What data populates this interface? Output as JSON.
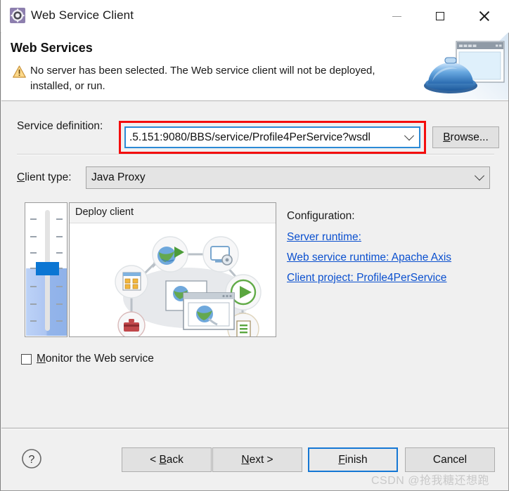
{
  "window": {
    "title": "Web Service Client",
    "icon": "gear-icon",
    "controls": {
      "minimize": "minimize-icon",
      "maximize": "maximize-icon",
      "close": "close-icon"
    }
  },
  "header": {
    "title": "Web Services",
    "warning_icon": "warning-triangle-icon",
    "warning_text": "No server has been selected. The Web service client will not be deployed, installed, or run.",
    "banner_icon": "server-window-icon"
  },
  "form": {
    "service_definition": {
      "label": "Service definition:",
      "value": ".5.151:9080/BBS/service/Profile4PerService?wsdl",
      "browse_label": "Browse...",
      "highlight_color": "#f40d0d",
      "focus_color": "#2b8ad6"
    },
    "client_type": {
      "label": "Client type:",
      "value": "Java Proxy"
    },
    "monitor": {
      "label": "Monitor the Web service",
      "checked": false
    }
  },
  "stage": {
    "illustration_title": "Deploy client",
    "slider_name": "deployment-stage-slider"
  },
  "configuration": {
    "title": "Configuration:",
    "links": [
      {
        "label": "Server runtime: ",
        "name": "server-runtime-link"
      },
      {
        "label": "Web service runtime: Apache Axis",
        "name": "web-service-runtime-link"
      },
      {
        "label": "Client project: Profile4PerService",
        "name": "client-project-link"
      }
    ],
    "link_color": "#0b50cf"
  },
  "footer": {
    "help_icon": "help-question-icon",
    "buttons": {
      "back": {
        "pre": "< ",
        "accel": "B",
        "post": "ack"
      },
      "next": {
        "pre": "",
        "accel": "N",
        "post": "ext >"
      },
      "finish": {
        "pre": "",
        "accel": "F",
        "post": "inish"
      },
      "cancel": {
        "pre": "",
        "accel": "",
        "post": "Cancel"
      }
    },
    "default_button": "finish"
  },
  "watermark": "CSDN @抢我糖还想跑"
}
